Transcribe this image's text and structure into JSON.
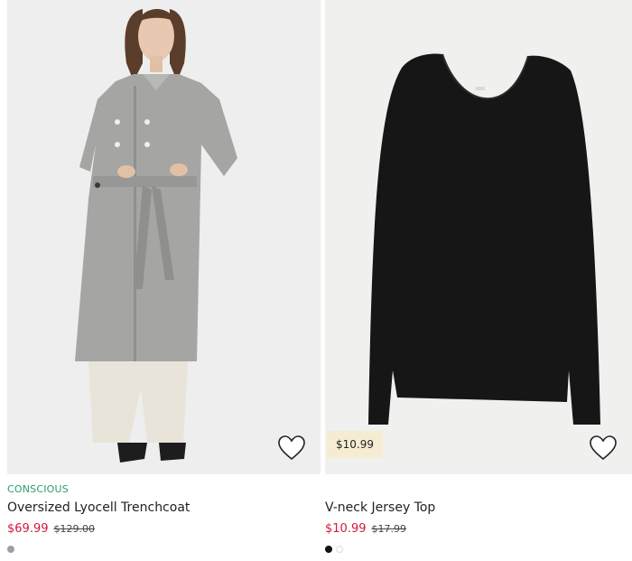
{
  "products": [
    {
      "badge": "CONSCIOUS",
      "title": "Oversized Lyocell Trenchcoat",
      "sale_price": "$69.99",
      "original_price": "$129.00",
      "swatches": [
        "#9aa1a8"
      ],
      "favorite_icon": "heart-outline-icon"
    },
    {
      "badge": "",
      "title": "V-neck Jersey Top",
      "sale_price": "$10.99",
      "original_price": "$17.99",
      "price_tag": "$10.99",
      "swatches": [
        "#111111",
        "#ffffff"
      ],
      "favorite_icon": "heart-outline-icon"
    }
  ]
}
